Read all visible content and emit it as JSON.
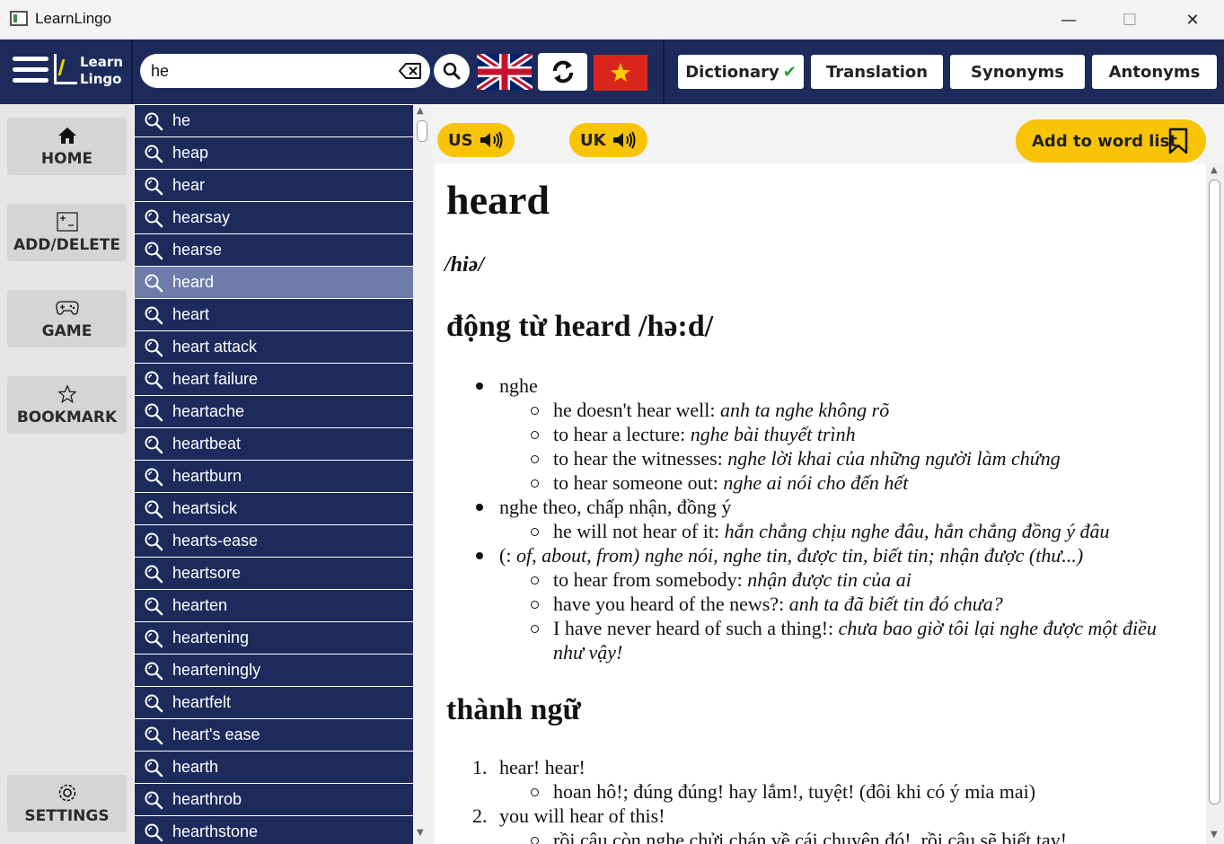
{
  "window": {
    "title": "LearnLingo",
    "minimize_glyph": "—",
    "maximize_glyph": "☐",
    "close_glyph": "✕"
  },
  "logo": {
    "line1": "Learn",
    "line2": "Lingo"
  },
  "search": {
    "value": "he",
    "placeholder": ""
  },
  "language": {
    "source": "uk-flag-icon",
    "target": "vietnam-flag-icon"
  },
  "modes": [
    {
      "label": "Dictionary",
      "active": true
    },
    {
      "label": "Translation"
    },
    {
      "label": "Synonyms"
    },
    {
      "label": "Antonyms"
    }
  ],
  "sidebar": {
    "items": [
      {
        "label": "HOME",
        "icon": "home-icon"
      },
      {
        "label": "ADD/DELETE",
        "icon": "add-delete-icon"
      },
      {
        "label": "GAME",
        "icon": "gamepad-icon"
      },
      {
        "label": "BOOKMARK",
        "icon": "star-icon"
      },
      {
        "label": "SETTINGS",
        "icon": "gear-icon"
      }
    ]
  },
  "word_list": [
    "he",
    "heap",
    "hear",
    "hearsay",
    "hearse",
    "heard",
    "heart",
    "heart attack",
    "heart failure",
    "heartache",
    "heartbeat",
    "heartburn",
    "heartsick",
    "hearts-ease",
    "heartsore",
    "hearten",
    "heartening",
    "hearteningly",
    "heartfelt",
    "heart's ease",
    "hearth",
    "hearthrob",
    "hearthstone"
  ],
  "selected_word_index": 5,
  "pronunciation": {
    "us": "US",
    "uk": "UK"
  },
  "add_button": "Add to word list",
  "entry": {
    "word": "heard",
    "ipa": "/hiə/",
    "pos_heading": "động từ heard /hə:d/",
    "s1": "nghe",
    "s1e1a": "he doesn't hear well: ",
    "s1e1b": "anh ta nghe không rõ",
    "s1e2a": "to hear a lecture: ",
    "s1e2b": "nghe bài thuyết trình",
    "s1e3a": "to hear the witnesses: ",
    "s1e3b": "nghe lời khai của những người làm chứng",
    "s1e4a": "to hear someone out: ",
    "s1e4b": "nghe ai nói cho đến hết",
    "s2": "nghe theo, chấp nhận, đồng ý",
    "s2e1a": "he will not hear of it: ",
    "s2e1b": "hắn chẳng chịu nghe đâu, hắn chẳng đồng ý đâu",
    "s3a": "(: ",
    "s3b": "of, about, from)",
    "s3c": " nghe nói, nghe tin, được tin, biết tin; nhận được (thư...)",
    "s3e1a": "to hear from somebody: ",
    "s3e1b": "nhận được tin của ai",
    "s3e2a": "have you heard of the news?: ",
    "s3e2b": "anh ta đã biết tin đó chưa?",
    "s3e3a": "I have never heard of such a thing!: ",
    "s3e3b": "chưa bao giờ tôi lại nghe được một điều",
    "s3e3c": "như vậy!",
    "idiom_heading": "thành ngữ",
    "i1num": "1.",
    "i1": "hear! hear!",
    "i1e1": "hoan hô!; đúng đúng! hay lắm!, tuyệt! (đôi khi có ý mỉa mai)",
    "i2num": "2.",
    "i2": "you will hear of this!",
    "i2e1": "rồi cậu còn nghe chửi chán về cái chuyện đó!, rồi cậu sẽ biết tay!"
  },
  "colors": {
    "header": "#1c2b5c",
    "list_item": "#1c2b5c",
    "list_selected": "#6d7ca8",
    "accent": "#f9c307"
  }
}
